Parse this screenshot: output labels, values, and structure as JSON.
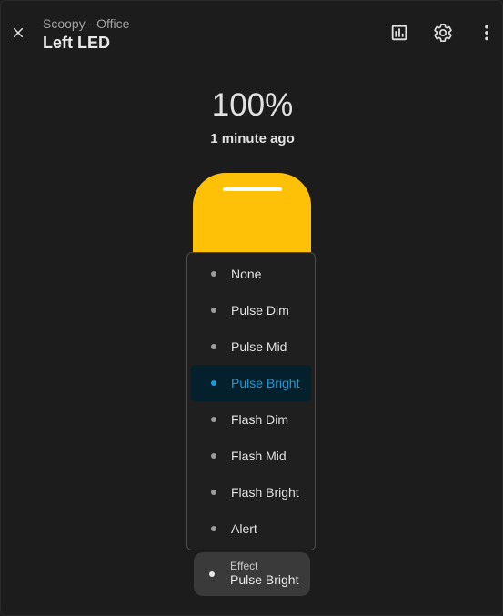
{
  "header": {
    "subtitle": "Scoopy - Office",
    "title": "Left LED",
    "close_icon": "close-icon",
    "history_icon": "chart-bar-icon",
    "settings_icon": "gear-icon",
    "more_icon": "more-vertical-icon"
  },
  "state": {
    "value": "100%",
    "brightness": 100,
    "last_changed": "1 minute ago"
  },
  "colors": {
    "light": "#ffc107",
    "accent": "#1e9bd7",
    "background": "#1c1c1c"
  },
  "effect_menu": {
    "selected": "Pulse Bright",
    "options": [
      {
        "label": "None"
      },
      {
        "label": "Pulse Dim"
      },
      {
        "label": "Pulse Mid"
      },
      {
        "label": "Pulse Bright"
      },
      {
        "label": "Flash Dim"
      },
      {
        "label": "Flash Mid"
      },
      {
        "label": "Flash Bright"
      },
      {
        "label": "Alert"
      }
    ]
  },
  "effect_control": {
    "label": "Effect",
    "value": "Pulse Bright"
  }
}
